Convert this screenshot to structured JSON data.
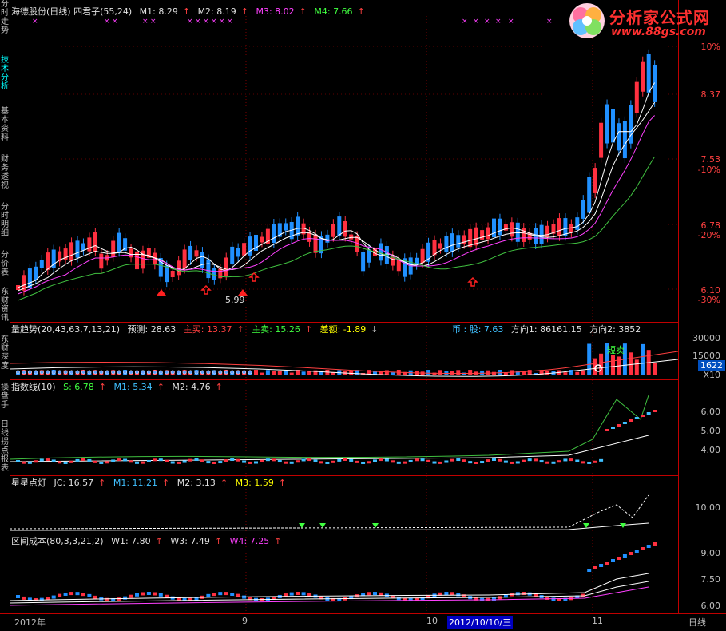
{
  "left_tabs": [
    "分时走势",
    "技术分析",
    "基本资料",
    "财务透视",
    "分时明细",
    "分价表",
    "东财资讯",
    "东财深度",
    "操盘手",
    "日线拐点报表"
  ],
  "panel1": {
    "title": "海德股份(日线) 四君子(55,24)",
    "m1": "M1: 8.29",
    "m2": "M2: 8.19",
    "m3": "M3: 8.02",
    "m4": "M4: 7.66",
    "axis": [
      {
        "v": "10%",
        "pct": true
      },
      {
        "v": "8.37",
        "pct": false
      },
      {
        "v": "7.53",
        "pct": false
      },
      {
        "v": "-10%",
        "pct": true
      },
      {
        "v": "6.78",
        "pct": false
      },
      {
        "v": "-20%",
        "pct": true
      },
      {
        "v": "6.10",
        "pct": false
      },
      {
        "v": "-30%",
        "pct": true
      }
    ],
    "low_label": "5.99"
  },
  "panel2": {
    "title": "量趋势(20,43,63,7,13,21)",
    "forecast": "预测: 28.63",
    "buy": "主买: 13.37",
    "sell": "主卖: 15.26",
    "diff": "差额: -1.89",
    "currency": "币 : 股: 7.63",
    "dir1": "方向1: 86161.15",
    "dir2": "方向2: 3852",
    "note": "短卖",
    "axis": [
      "30000",
      "15000",
      "1622",
      "X10"
    ]
  },
  "panel3": {
    "title": "指数线(10)",
    "s": "S: 6.78",
    "m1": "M1: 5.34",
    "m2": "M2: 4.76",
    "axis": [
      "6.00",
      "5.00",
      "4.00"
    ]
  },
  "panel4": {
    "title": "星星点灯",
    "jc": "JC: 16.57",
    "m1": "M1: 11.21",
    "m2": "M2: 3.13",
    "m3": "M3: 1.59",
    "axis": [
      "10.00"
    ]
  },
  "panel5": {
    "title": "区间成本(80,3,3,21,2)",
    "w1": "W1: 7.80",
    "w3": "W3: 7.49",
    "w4": "W4: 7.25",
    "axis": [
      "9.00",
      "7.50",
      "6.00"
    ]
  },
  "bottom": {
    "dates": [
      "2012年",
      "9",
      "10",
      "2012/10/10/三",
      "11"
    ],
    "period": "日线"
  },
  "logo": {
    "line1": "分析家公式网",
    "line2": "www.88gs.com"
  },
  "colors": {
    "up": "#ff3040",
    "down": "#2090ff",
    "bg": "#000000",
    "grid": "#c00000"
  }
}
